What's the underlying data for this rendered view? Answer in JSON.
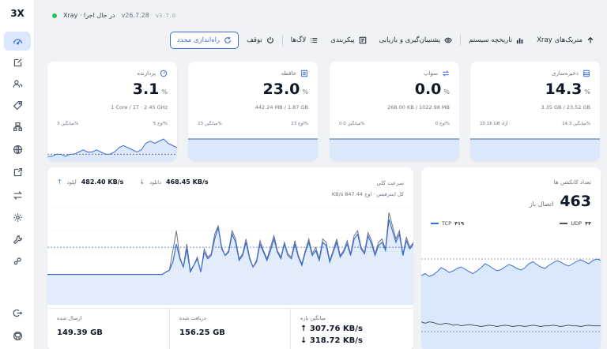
{
  "brand": "3X",
  "header": {
    "status_text": "Xray · در حال اجرا",
    "version": "v26.7.28",
    "core_version": "v3.7.0"
  },
  "toolbar": [
    {
      "label": "Xray متریک‌های",
      "icon": "arrow-up-icon",
      "name": "xray-metrics"
    },
    {
      "label": "تاریخچه سیستم",
      "icon": "bar-chart-icon",
      "name": "system-history"
    },
    {
      "label": "پشتیبان‌گیری و بازیابی",
      "icon": "eye-icon",
      "name": "backup-restore"
    },
    {
      "label": "پیکربندی",
      "icon": "config-icon",
      "name": "config"
    },
    {
      "label": "لاگ‌ها",
      "icon": "list-icon",
      "name": "logs"
    },
    {
      "label": "توقف",
      "icon": "power-icon",
      "name": "stop"
    },
    {
      "label": "راه‌اندازی مجدد",
      "icon": "refresh-icon",
      "name": "restart"
    }
  ],
  "sidebar_icons": [
    "dashboard-icon",
    "edit-icon",
    "users-icon",
    "tag-icon",
    "server-icon",
    "globe-icon",
    "external-icon",
    "arrows-icon",
    "settings-icon",
    "wrench-icon",
    "gear-link-icon",
    "logout-icon",
    "github-icon"
  ],
  "cards": [
    {
      "name": "cpu",
      "title": "پردازنده",
      "icon": "cpu-icon",
      "value": "3.1",
      "unit": "%",
      "sub": "1 Core / 1T · 2.45 GHz",
      "min_label": "3 میانگین%",
      "max_label": "5 اوج%",
      "spark": [
        2,
        2,
        3,
        3,
        2,
        3,
        3,
        4,
        5,
        4,
        4,
        5,
        4,
        3,
        3,
        4,
        6,
        7,
        6,
        5,
        4,
        5,
        8,
        9,
        8,
        9,
        10,
        8,
        7,
        6
      ],
      "avg": 3
    },
    {
      "name": "memory",
      "title": "حافظه",
      "icon": "memory-icon",
      "value": "23.0",
      "unit": "%",
      "sub": "442.24 MB / 1.87 GB",
      "min_label": "23 میانگین%",
      "max_label": "23 اوج%",
      "spark": [
        23,
        23,
        23,
        23,
        23,
        23,
        23,
        23,
        23,
        23,
        23,
        23,
        23,
        23,
        23,
        23,
        23,
        23,
        23,
        23,
        23,
        23,
        23,
        23,
        23,
        23,
        23,
        23,
        23,
        23
      ],
      "avg": 23
    },
    {
      "name": "swap",
      "title": "سواپ",
      "icon": "swap-icon",
      "value": "0.0",
      "unit": "%",
      "sub": "268.00 KB / 1022.98 MB",
      "min_label": "0.0 میانگین%",
      "max_label": "0 اوج%",
      "spark": [
        0,
        0,
        0,
        0,
        0,
        0,
        0,
        0,
        0,
        0,
        0,
        0,
        0,
        0,
        0,
        0,
        0,
        0,
        0,
        0,
        0,
        0,
        0,
        0,
        0,
        0,
        0,
        0,
        0,
        0
      ],
      "avg": 0
    },
    {
      "name": "storage",
      "title": "ذخیره‌سازی",
      "icon": "storage-icon",
      "value": "14.3",
      "unit": "%",
      "sub": "3.35 GB / 23.52 GB",
      "min_label": "20.16 GB آزاد",
      "max_label": "14.3 میانگین%",
      "spark": [
        14,
        14,
        14,
        14,
        14,
        14,
        14,
        14,
        14,
        14,
        14,
        14,
        14,
        14,
        14,
        14,
        14,
        14,
        14,
        14,
        14,
        14,
        14,
        14,
        14,
        14,
        14,
        14,
        14,
        14
      ],
      "avg": 14
    }
  ],
  "traffic": {
    "title": "سرعت کلی",
    "upload_label": "آپلود",
    "upload_value": "482.40 KB/s",
    "download_label": "دانلود",
    "download_value": "468.45 KB/s",
    "total_label": "کل اینترفیس · اوج 847.44 KB/s",
    "chart_a": [
      330,
      330,
      330,
      330,
      330,
      330,
      330,
      330,
      330,
      330,
      330,
      330,
      330,
      330,
      330,
      330,
      330,
      330,
      330,
      330,
      330,
      330,
      330,
      330,
      330,
      330,
      330,
      330,
      330,
      330,
      330,
      330,
      330,
      330,
      360,
      380,
      480,
      700,
      520,
      420,
      640,
      360,
      440,
      520,
      360,
      600,
      520,
      560,
      760,
      900,
      640,
      560,
      600,
      820,
      720,
      500,
      560,
      720,
      520,
      420,
      480,
      700,
      600,
      500,
      620,
      760,
      600,
      520,
      700,
      560,
      520,
      700,
      540,
      440,
      600,
      720,
      560,
      620,
      500,
      720,
      680,
      480,
      600,
      720,
      540,
      600,
      700,
      560,
      760,
      820,
      640,
      580,
      800,
      700,
      560,
      680,
      720,
      620,
      1000,
      860,
      720,
      820,
      560,
      740,
      640,
      700
    ],
    "chart_b": [
      330,
      330,
      330,
      330,
      330,
      330,
      330,
      330,
      330,
      330,
      330,
      330,
      330,
      330,
      330,
      330,
      330,
      330,
      330,
      330,
      330,
      330,
      330,
      330,
      330,
      330,
      330,
      330,
      330,
      330,
      330,
      330,
      330,
      330,
      360,
      380,
      620,
      860,
      540,
      420,
      700,
      380,
      440,
      540,
      360,
      640,
      540,
      580,
      820,
      920,
      660,
      560,
      620,
      860,
      760,
      520,
      580,
      760,
      540,
      420,
      500,
      740,
      620,
      520,
      660,
      800,
      620,
      540,
      720,
      580,
      540,
      740,
      560,
      460,
      620,
      760,
      580,
      660,
      520,
      760,
      720,
      500,
      620,
      760,
      560,
      620,
      740,
      580,
      800,
      860,
      660,
      600,
      840,
      740,
      580,
      720,
      760,
      640,
      1080,
      920,
      760,
      860,
      580,
      780,
      660,
      720
    ],
    "avg_line": 660,
    "sent_label": "ارسال شده",
    "sent_value": "149.39 GB",
    "recv_label": "دریافت شده",
    "recv_value": "156.25 GB",
    "avg_label": "میانگین بازه",
    "avg_up": "↑ 307.76 KB/s",
    "avg_down": "↓ 318.72 KB/s"
  },
  "connections": {
    "title": "تعداد کانکشن ها",
    "value": "463",
    "value_label": "اتصال باز",
    "tcp_label": "TCP",
    "tcp_value": "۴۱۹",
    "udp_label": "UDP",
    "udp_value": "۴۴",
    "tcp_color": "#3b6fd6",
    "udp_color": "#4b5563",
    "tcp_series": [
      380,
      385,
      378,
      382,
      390,
      400,
      395,
      388,
      392,
      398,
      402,
      396,
      390,
      385,
      392,
      400,
      410,
      405,
      398,
      392,
      395,
      402,
      408,
      404,
      398,
      394,
      400,
      410,
      415,
      408,
      402,
      398,
      406,
      412,
      418,
      414,
      408,
      404,
      410,
      416,
      420,
      415,
      410,
      418,
      422,
      419
    ],
    "udp_series": [
      50,
      48,
      50,
      49,
      47,
      46,
      48,
      47,
      45,
      46,
      44,
      45,
      46,
      45,
      44,
      43,
      44,
      45,
      44,
      43,
      44,
      45,
      44,
      43,
      44,
      44,
      43,
      44,
      45,
      44,
      43,
      44,
      44,
      45,
      44,
      43,
      44,
      45,
      44,
      44,
      43,
      44,
      45,
      44,
      44,
      44
    ]
  }
}
